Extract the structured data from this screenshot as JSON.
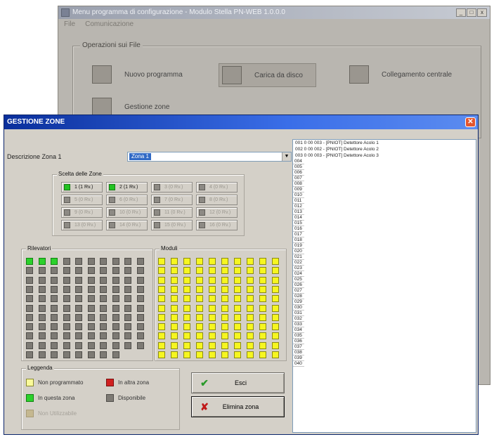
{
  "bg_window": {
    "title": "Menu programma di configurazione - Modulo Stella PN-WEB 1.0.0.0",
    "menu": [
      "File",
      "Comunicazione"
    ],
    "group_label": "Operazioni sui File",
    "items": [
      {
        "label": "Nuovo programma",
        "icon": "document-icon"
      },
      {
        "label": "Carica da disco",
        "icon": "disk-load-icon"
      },
      {
        "label": "Collegamento centrale",
        "icon": "connection-icon"
      },
      {
        "label": "Gestione zone",
        "icon": "zones-icon"
      }
    ]
  },
  "dialog": {
    "title": "GESTIONE ZONE",
    "close_glyph": "✕",
    "zone_desc_label": "Descrizione Zona 1",
    "zone_combo_value": "Zona 1",
    "zone_list_caption": "Scelta delle Zone",
    "zones": [
      {
        "label": "1 (1 Rv.)",
        "active": true
      },
      {
        "label": "2 (1 Rv.)",
        "active": true
      },
      {
        "label": "3 (0 Rv.)",
        "active": false
      },
      {
        "label": "4 (0 Rv.)",
        "active": false
      },
      {
        "label": "5 (0 Rv.)",
        "active": false
      },
      {
        "label": "6 (0 Rv.)",
        "active": false
      },
      {
        "label": "7 (0 Rv.)",
        "active": false
      },
      {
        "label": "8 (0 Rv.)",
        "active": false
      },
      {
        "label": "9 (0 Rv.)",
        "active": false
      },
      {
        "label": "10 (0 Rv.)",
        "active": false
      },
      {
        "label": "11 (0 Rv.)",
        "active": false
      },
      {
        "label": "12 (0 Rv.)",
        "active": false
      },
      {
        "label": "13 (0 Rv.)",
        "active": false
      },
      {
        "label": "14 (0 Rv.)",
        "active": false
      },
      {
        "label": "15 (0 Rv.)",
        "active": false
      },
      {
        "label": "16 (0 Rv.)",
        "active": false
      }
    ],
    "detectors_caption": "Rilevatori",
    "modules_caption": "Moduli",
    "legend_caption": "Leggenda",
    "legend": [
      {
        "label": "Non programmato",
        "swatch": "yellow"
      },
      {
        "label": "In altra zona",
        "swatch": "red"
      },
      {
        "label": "In questa zona",
        "swatch": "green"
      },
      {
        "label": "Disponibile",
        "swatch": "gray"
      },
      {
        "label": "Non Utilizzabile",
        "swatch": "dis"
      }
    ],
    "ok_label": "Esci",
    "ok_icon": "✔",
    "cancel_label": "Elimina zona",
    "cancel_icon": "✘",
    "list_items": [
      "001 0 00 003 - [PNIOT] Detettore Acolo 1",
      "002 0 00 002 - [PNIOT] Detettore Acolo 2",
      "003 0 00 003 - [PNIOT] Detettore Acolo 3"
    ],
    "list_numbers": [
      "004",
      "005",
      "006",
      "007",
      "008",
      "009",
      "010",
      "011",
      "012",
      "013",
      "014",
      "015",
      "016",
      "017",
      "018",
      "019",
      "020",
      "021",
      "022",
      "023",
      "024",
      "025",
      "026",
      "027",
      "028",
      "029",
      "030",
      "031",
      "032",
      "033",
      "034",
      "035",
      "036",
      "037",
      "038",
      "039",
      "040"
    ]
  }
}
